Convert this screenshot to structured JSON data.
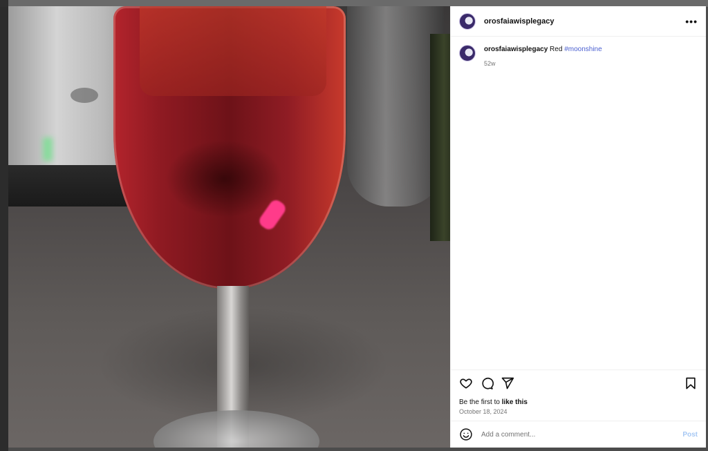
{
  "post": {
    "username": "orosfaiawisplegacy",
    "more_icon": "more-horizontal-icon",
    "caption": {
      "username": "orosfaiawisplegacy",
      "text": "Red",
      "hashtag": "#moonshine"
    },
    "time_ago": "52w",
    "likes": {
      "prefix": "Be the first to",
      "action": "like this"
    },
    "date": "October 18, 2024",
    "actions": [
      "heart-icon",
      "comment-icon",
      "share-icon",
      "bookmark-icon"
    ],
    "comment_input": {
      "placeholder": "Add a comment...",
      "value": ""
    },
    "post_label": "Post"
  },
  "colors": {
    "hashtag": "#4a5fd0",
    "post_button": "#a6c8f4",
    "secondary_text": "#737373"
  }
}
